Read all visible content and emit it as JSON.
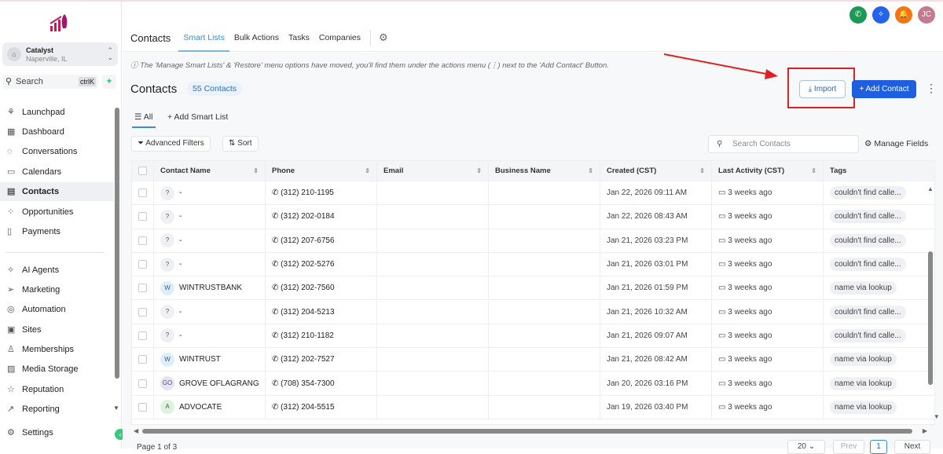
{
  "sidebar": {
    "location_name": "Catalyst",
    "location_sub": "Naperville, IL",
    "search": "Search",
    "shortcut": "ctrlK",
    "items": [
      {
        "label": "Launchpad",
        "icon": "rocket-icon"
      },
      {
        "label": "Dashboard",
        "icon": "dashboard-icon"
      },
      {
        "label": "Conversations",
        "icon": "chat-icon"
      },
      {
        "label": "Calendars",
        "icon": "calendar-icon"
      },
      {
        "label": "Contacts",
        "icon": "contacts-icon"
      },
      {
        "label": "Opportunities",
        "icon": "opportunities-icon"
      },
      {
        "label": "Payments",
        "icon": "payments-icon"
      },
      {
        "label": "AI Agents",
        "icon": "sparkle-icon"
      },
      {
        "label": "Marketing",
        "icon": "send-icon"
      },
      {
        "label": "Automation",
        "icon": "automation-icon"
      },
      {
        "label": "Sites",
        "icon": "sites-icon"
      },
      {
        "label": "Memberships",
        "icon": "memberships-icon"
      },
      {
        "label": "Media Storage",
        "icon": "image-icon"
      },
      {
        "label": "Reputation",
        "icon": "star-icon"
      },
      {
        "label": "Reporting",
        "icon": "chart-icon"
      },
      {
        "label": "Settings",
        "icon": "gear-icon"
      }
    ]
  },
  "header": {
    "title": "Contacts",
    "tabs": [
      "Smart Lists",
      "Bulk Actions",
      "Tasks",
      "Companies"
    ],
    "avatar": "JC",
    "colors": {
      "phone": "#1a9a55",
      "ai": "#2563eb",
      "bell": "#f97316",
      "avatar": "#c47a8f"
    }
  },
  "notice": "ⓘ The 'Manage Smart Lists' & 'Restore' menu options have moved, you'll find them under the actions menu (⋮) next to the 'Add Contact' Button.",
  "page": {
    "title": "Contacts",
    "count": "55 Contacts",
    "import": "Import",
    "add_contact": "Add Contact",
    "smart_all": "All",
    "add_smart_list": "Add Smart List",
    "advanced_filters": "Advanced Filters",
    "sort": "Sort",
    "search_placeholder": "Search Contacts",
    "manage_fields": "Manage Fields"
  },
  "table": {
    "columns": [
      "Contact Name",
      "Phone",
      "Email",
      "Business Name",
      "Created (CST)",
      "Last Activity (CST)",
      "Tags"
    ],
    "rows": [
      {
        "initial": "?",
        "name": "-",
        "phone": "(312) 210-1195",
        "created": "Jan 22, 2026 09:11 AM",
        "activity": "3 weeks ago",
        "tag": "couldn't find calle..."
      },
      {
        "initial": "?",
        "name": "-",
        "phone": "(312) 202-0184",
        "created": "Jan 22, 2026 08:43 AM",
        "activity": "3 weeks ago",
        "tag": "couldn't find calle..."
      },
      {
        "initial": "?",
        "name": "-",
        "phone": "(312) 207-6756",
        "created": "Jan 21, 2026 03:23 PM",
        "activity": "3 weeks ago",
        "tag": "couldn't find calle..."
      },
      {
        "initial": "?",
        "name": "-",
        "phone": "(312) 202-5276",
        "created": "Jan 21, 2026 03:01 PM",
        "activity": "3 weeks ago",
        "tag": "couldn't find calle..."
      },
      {
        "initial": "W",
        "name": "WINTRUSTBANK",
        "phone": "(312) 202-7560",
        "created": "Jan 21, 2026 01:59 PM",
        "activity": "3 weeks ago",
        "tag": "name via lookup"
      },
      {
        "initial": "?",
        "name": "-",
        "phone": "(312) 204-5213",
        "created": "Jan 21, 2026 10:32 AM",
        "activity": "3 weeks ago",
        "tag": "couldn't find calle..."
      },
      {
        "initial": "?",
        "name": "-",
        "phone": "(312) 210-1182",
        "created": "Jan 21, 2026 09:07 AM",
        "activity": "3 weeks ago",
        "tag": "couldn't find calle..."
      },
      {
        "initial": "W",
        "name": "WINTRUST",
        "phone": "(312) 202-7527",
        "created": "Jan 21, 2026 08:42 AM",
        "activity": "3 weeks ago",
        "tag": "name via lookup"
      },
      {
        "initial": "GO",
        "name": "GROVE OFLAGRANG",
        "phone": "(708) 354-7300",
        "created": "Jan 20, 2026 03:16 PM",
        "activity": "3 weeks ago",
        "tag": "name via lookup"
      },
      {
        "initial": "A",
        "name": "ADVOCATE",
        "phone": "(312) 204-5515",
        "created": "Jan 19, 2026 03:40 PM",
        "activity": "3 weeks ago",
        "tag": "name via lookup"
      }
    ]
  },
  "pagination": {
    "label": "Page 1 of 3",
    "per_page": "20",
    "prev": "Prev",
    "current": "1",
    "next": "Next"
  }
}
